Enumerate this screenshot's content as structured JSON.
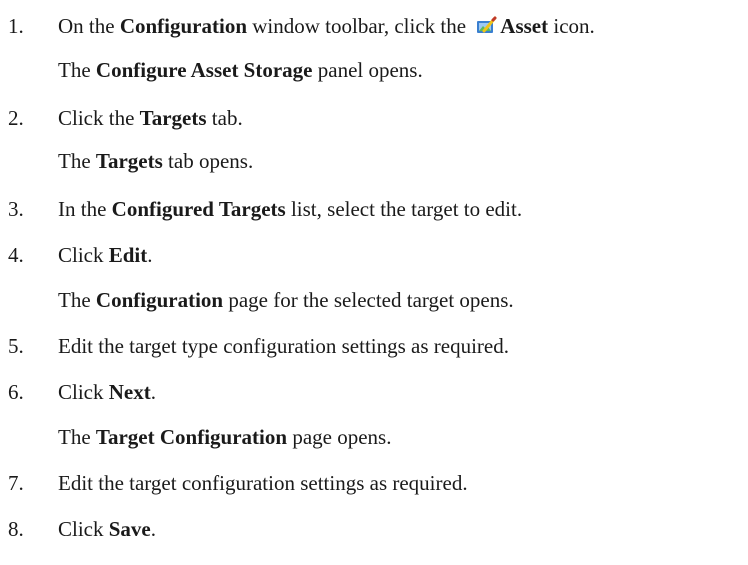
{
  "steps": [
    {
      "number": "1.",
      "parts": [
        "On the ",
        "Configuration",
        " window toolbar, click the ",
        "Asset",
        " icon."
      ],
      "icon": "asset-icon",
      "result_parts": [
        "The ",
        "Configure Asset Storage",
        " panel opens."
      ]
    },
    {
      "number": "2.",
      "parts": [
        "Click the ",
        "Targets",
        " tab."
      ],
      "result_parts": [
        "The ",
        "Targets",
        " tab opens."
      ]
    },
    {
      "number": "3.",
      "parts": [
        "In the ",
        "Configured Targets",
        " list, select the target to edit."
      ]
    },
    {
      "number": "4.",
      "parts": [
        "Click ",
        "Edit",
        "."
      ],
      "result_parts": [
        "The ",
        "Configuration",
        " page for the selected target opens."
      ]
    },
    {
      "number": "5.",
      "parts": [
        "Edit the target type configuration settings as required."
      ]
    },
    {
      "number": "6.",
      "parts": [
        "Click ",
        "Next",
        "."
      ],
      "result_parts": [
        "The ",
        "Target Configuration",
        " page opens."
      ]
    },
    {
      "number": "7.",
      "parts": [
        "Edit the target configuration settings as required."
      ]
    },
    {
      "number": "8.",
      "parts": [
        "Click ",
        "Save",
        "."
      ]
    }
  ],
  "colors": {
    "text": "#1a1a1a",
    "icon_blue": "#3a7fd0",
    "icon_green": "#5cb85c",
    "icon_yellow": "#f0c419"
  }
}
